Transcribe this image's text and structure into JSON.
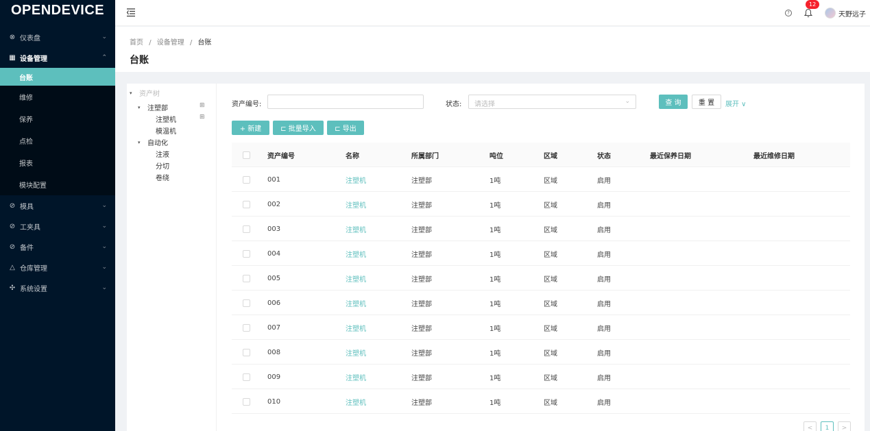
{
  "app": {
    "logo": "OPENDEVICE"
  },
  "sidebar": {
    "items": [
      {
        "label": "仪表盘",
        "icon": "dashboard-icon",
        "glyph": "⊗",
        "arrow": "⌄"
      },
      {
        "label": "设备管理",
        "icon": "table-icon",
        "glyph": "▦",
        "arrow": "⌃",
        "children": [
          {
            "label": "台账"
          },
          {
            "label": "维修"
          },
          {
            "label": "保养"
          },
          {
            "label": "点检"
          },
          {
            "label": "报表"
          },
          {
            "label": "模块配置"
          }
        ]
      },
      {
        "label": "模具",
        "icon": "check-circle-icon",
        "glyph": "⊘",
        "arrow": "⌄"
      },
      {
        "label": "工夹具",
        "icon": "check-circle-icon",
        "glyph": "⊘",
        "arrow": "⌄"
      },
      {
        "label": "备件",
        "icon": "check-circle-icon",
        "glyph": "⊘",
        "arrow": "⌄"
      },
      {
        "label": "仓库管理",
        "icon": "warning-icon",
        "glyph": "△",
        "arrow": "⌄"
      },
      {
        "label": "系统设置",
        "icon": "settings-icon",
        "glyph": "✣",
        "arrow": "⌄"
      }
    ]
  },
  "header": {
    "help_glyph": "?",
    "notification_count": "12",
    "username": "天野远子"
  },
  "page": {
    "breadcrumb": [
      "首页",
      "设备管理",
      "台账"
    ],
    "breadcrumb_sep": "/",
    "title": "台账"
  },
  "tree": {
    "root": "资产树",
    "nodes": [
      {
        "label": "注塑部",
        "level": 1,
        "caret": "▾",
        "op": "⊞"
      },
      {
        "label": "注塑机",
        "level": 2,
        "caret": "",
        "op": "⊞"
      },
      {
        "label": "模温机",
        "level": 2,
        "caret": "",
        "op": ""
      },
      {
        "label": "自动化",
        "level": 1,
        "caret": "▾",
        "op": ""
      },
      {
        "label": "注液",
        "level": 2,
        "caret": "",
        "op": ""
      },
      {
        "label": "分切",
        "level": 2,
        "caret": "",
        "op": ""
      },
      {
        "label": "卷绕",
        "level": 2,
        "caret": "",
        "op": ""
      }
    ]
  },
  "search": {
    "asset_label": "资产编号:",
    "asset_value": "",
    "status_label": "状态:",
    "status_placeholder": "请选择",
    "query": "查 询",
    "reset": "重 置",
    "expand": "展开 ∨"
  },
  "toolbar": {
    "new": "+ 新建",
    "import": "⊏ 批量导入",
    "export": "⊏ 导出"
  },
  "table": {
    "columns": [
      "资产编号",
      "名称",
      "所属部门",
      "吨位",
      "区域",
      "状态",
      "最近保养日期",
      "最近维修日期"
    ],
    "rows": [
      [
        "001",
        "注塑机",
        "注塑部",
        "1吨",
        "区域",
        "启用",
        "",
        ""
      ],
      [
        "002",
        "注塑机",
        "注塑部",
        "1吨",
        "区域",
        "启用",
        "",
        ""
      ],
      [
        "003",
        "注塑机",
        "注塑部",
        "1吨",
        "区域",
        "启用",
        "",
        ""
      ],
      [
        "004",
        "注塑机",
        "注塑部",
        "1吨",
        "区域",
        "启用",
        "",
        ""
      ],
      [
        "005",
        "注塑机",
        "注塑部",
        "1吨",
        "区域",
        "启用",
        "",
        ""
      ],
      [
        "006",
        "注塑机",
        "注塑部",
        "1吨",
        "区域",
        "启用",
        "",
        ""
      ],
      [
        "007",
        "注塑机",
        "注塑部",
        "1吨",
        "区域",
        "启用",
        "",
        ""
      ],
      [
        "008",
        "注塑机",
        "注塑部",
        "1吨",
        "区域",
        "启用",
        "",
        ""
      ],
      [
        "009",
        "注塑机",
        "注塑部",
        "1吨",
        "区域",
        "启用",
        "",
        ""
      ],
      [
        "010",
        "注塑机",
        "注塑部",
        "1吨",
        "区域",
        "启用",
        "",
        ""
      ]
    ]
  },
  "pagination": {
    "prev": "<",
    "current": "1",
    "next": ">"
  },
  "colors": {
    "accent": "#5dbfbd",
    "sidebar": "#001529",
    "badge": "#f5222d"
  }
}
